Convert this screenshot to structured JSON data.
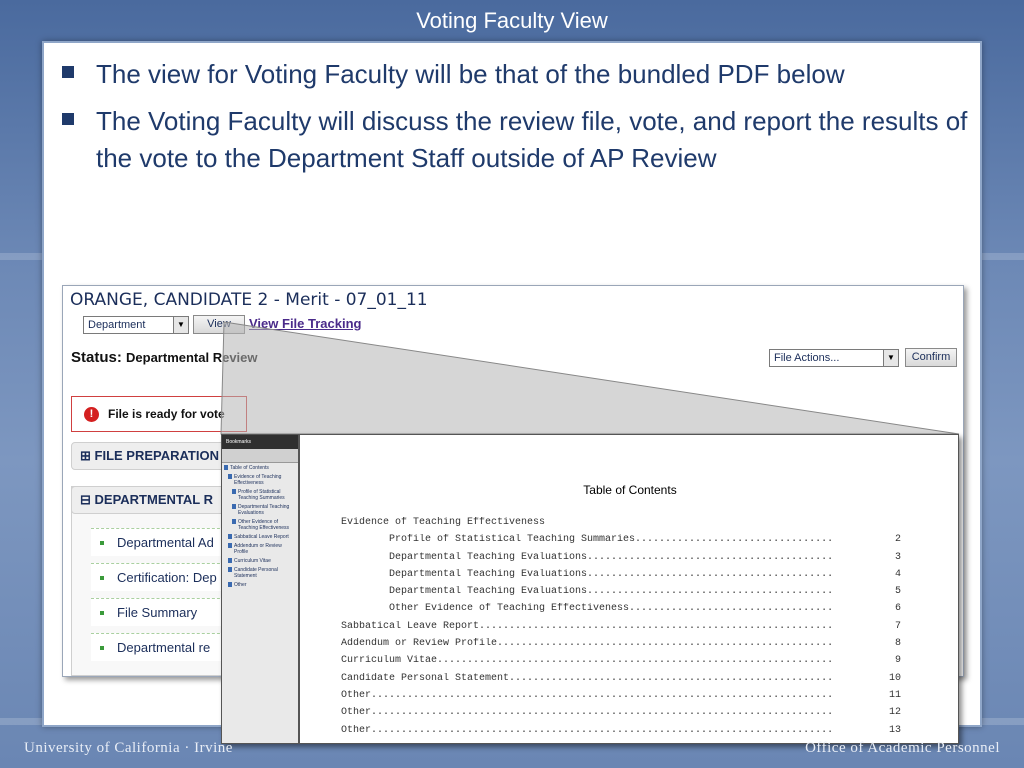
{
  "slide": {
    "title": "Voting Faculty View",
    "bullets": [
      "The view for Voting Faculty will be that of the bundled PDF below",
      "The Voting Faculty will discuss the review file, vote, and report the results of the vote to the Department Staff outside of AP Review"
    ],
    "footer_left": "University of California · Irvine",
    "footer_right": "Office of Academic Personnel"
  },
  "app": {
    "candidate_title": "ORANGE, CANDIDATE 2 - Merit - 07_01_11",
    "view_select_value": "Department",
    "view_button": "View",
    "view_tracking_link": "View File Tracking",
    "status_label": "Status:",
    "status_value": "Departmental Review",
    "file_actions_value": "File Actions...",
    "confirm_button": "Confirm",
    "vote_message": "File is ready for vote",
    "sections": [
      "FILE PREPARATION",
      "DEPARTMENTAL R"
    ],
    "department_items": [
      "Departmental Ad",
      "Certification: Dep",
      "File Summary",
      "Departmental re"
    ]
  },
  "pdf": {
    "bookmarks_title": "Bookmarks",
    "bookmarks": [
      "Table of Contents",
      "Evidence of Teaching Effectiveness",
      "Profile of Statistical Teaching Summaries",
      "Departmental Teaching Evaluations",
      "Other Evidence of Teaching Effectiveness",
      "Sabbatical Leave Report",
      "Addendum or Review Profile",
      "Curriculum Vitae",
      "Candidate Personal Statement",
      "Other"
    ],
    "toc_title": "Table of Contents",
    "toc": [
      {
        "text": "Evidence of Teaching Effectiveness",
        "page": ""
      },
      {
        "text": "        Profile of Statistical Teaching Summaries.................................",
        "page": "2"
      },
      {
        "text": "        Departmental Teaching Evaluations.........................................",
        "page": "3"
      },
      {
        "text": "        Departmental Teaching Evaluations.........................................",
        "page": "4"
      },
      {
        "text": "        Departmental Teaching Evaluations.........................................",
        "page": "5"
      },
      {
        "text": "        Other Evidence of Teaching Effectiveness..................................",
        "page": "6"
      },
      {
        "text": "Sabbatical Leave Report...........................................................",
        "page": "7"
      },
      {
        "text": "Addendum or Review Profile........................................................",
        "page": "8"
      },
      {
        "text": "Curriculum Vitae..................................................................",
        "page": "9"
      },
      {
        "text": "Candidate Personal Statement......................................................",
        "page": "10"
      },
      {
        "text": "Other.............................................................................",
        "page": "11"
      },
      {
        "text": "Other.............................................................................",
        "page": "12"
      },
      {
        "text": "Other.............................................................................",
        "page": "13"
      }
    ]
  }
}
